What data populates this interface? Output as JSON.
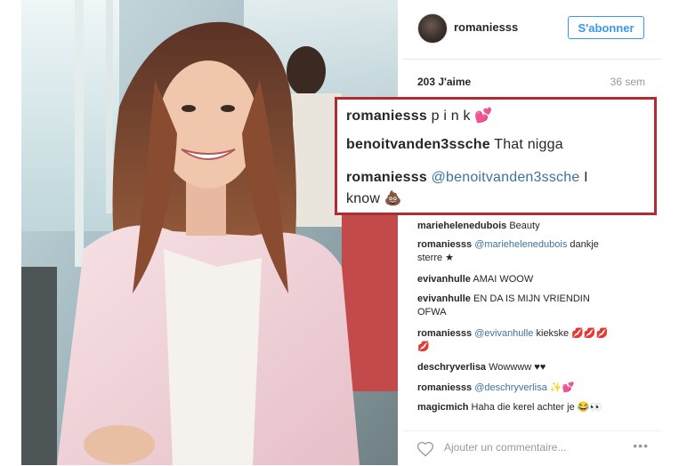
{
  "post": {
    "username": "romaniesss",
    "follow_label": "S'abonner",
    "likes": "203 J'aime",
    "age": "36 sem"
  },
  "highlighted_comments": [
    {
      "user": "romaniesss",
      "text": "p i n k 💕"
    },
    {
      "user": "benoitvanden3ssche",
      "text": "That nigga"
    },
    {
      "user": "romaniesss",
      "mention": "@benoitvanden3ssche",
      "text": "I",
      "text2": "know 💩"
    }
  ],
  "comments": [
    {
      "user": "mariehelenedubois",
      "text": "Beauty"
    },
    {
      "user": "romaniesss",
      "mention": "@mariehelenedubois",
      "text": "dankje",
      "text2": "sterre ★"
    },
    {
      "user": "evivanhulle",
      "text": "AMAI WOOW"
    },
    {
      "user": "evivanhulle",
      "text": "EN DA IS MIJN VRIENDIN",
      "text2": "OFWA"
    },
    {
      "user": "romaniesss",
      "mention": "@evivanhulle",
      "text": "kiekske 💋💋💋",
      "text2": "💋"
    },
    {
      "user": "deschryverlisa",
      "text": "Wowwww ♥♥"
    },
    {
      "user": "romaniesss",
      "mention": "@deschryverlisa",
      "text": "✨💕"
    },
    {
      "user": "magicmich",
      "text": "Haha die kerel achter je 😂👀"
    }
  ],
  "footer": {
    "add_comment_placeholder": "Ajouter un commentaire...",
    "more_label": "•••"
  },
  "colors": {
    "follow_blue": "#3897f0",
    "mention_blue": "#3f729b",
    "highlight_red": "#b22b30"
  },
  "icons": [
    "heart-icon",
    "more-options-icon"
  ]
}
